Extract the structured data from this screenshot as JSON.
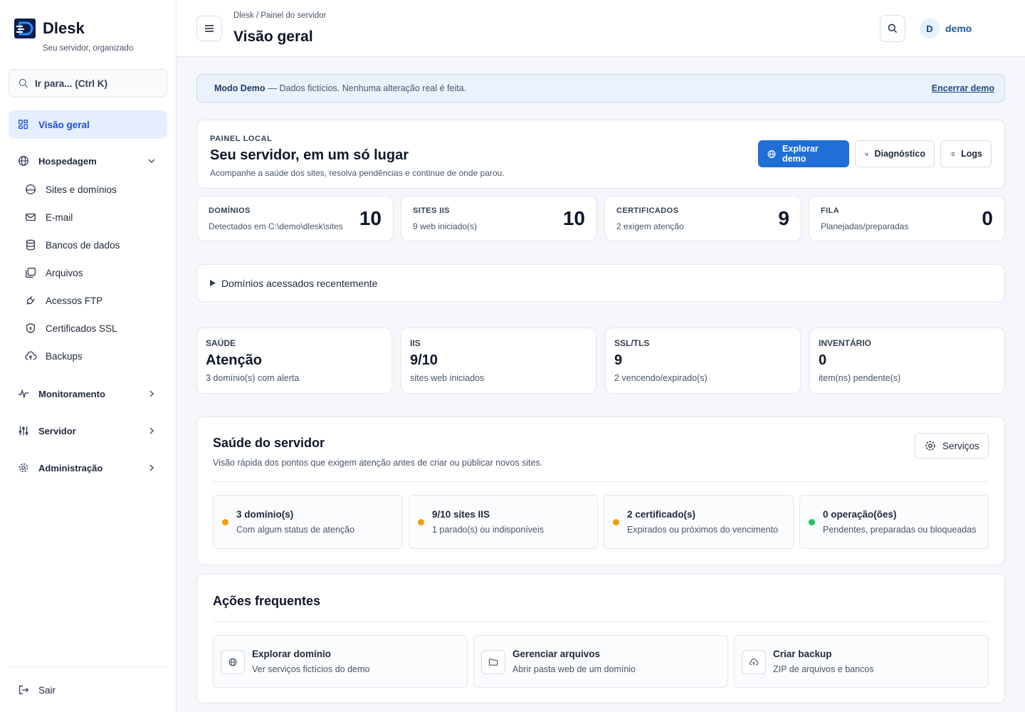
{
  "brand": {
    "name": "Dlesk",
    "tagline": "Seu servidor, organizado"
  },
  "search": {
    "label": "Ir para... (Ctrl K)"
  },
  "sidebar": {
    "items": [
      {
        "label": "Visão geral",
        "icon": "grid-icon",
        "active": true
      },
      {
        "label": "Hospedagem",
        "icon": "globe-icon",
        "group": true
      },
      {
        "label": "Sites e domínios",
        "icon": "www-icon"
      },
      {
        "label": "E-mail",
        "icon": "mail-icon"
      },
      {
        "label": "Bancos de dados",
        "icon": "database-icon"
      },
      {
        "label": "Arquivos",
        "icon": "files-icon"
      },
      {
        "label": "Acessos FTP",
        "icon": "plug-icon"
      },
      {
        "label": "Certificados SSL",
        "icon": "shield-icon"
      },
      {
        "label": "Backups",
        "icon": "cloud-upload-icon"
      },
      {
        "label": "Monitoramento",
        "icon": "pulse-icon",
        "group": true
      },
      {
        "label": "Servidor",
        "icon": "sliders-icon",
        "group": true
      },
      {
        "label": "Administração",
        "icon": "gear-icon",
        "group": true
      }
    ],
    "logout": "Sair"
  },
  "header": {
    "breadcrumb": "Dlesk / Painel do servidor",
    "title": "Visão geral",
    "user_initial": "D",
    "user_name": "demo"
  },
  "banner": {
    "strong": "Modo Demo",
    "text": "— Dados fictícios. Nenhuma alteração real é feita.",
    "action": "Encerrar demo"
  },
  "hero": {
    "eyebrow": "PAINEL LOCAL",
    "title": "Seu servidor, em um só lugar",
    "subtitle": "Acompanhe a saúde dos sites, resolva pendências e continue de onde parou.",
    "buttons": {
      "explore": "Explorar demo",
      "diagnostic": "Diagnóstico",
      "logs": "Logs"
    }
  },
  "stats": [
    {
      "label": "DOMÍNIOS",
      "sub": "Detectados em C:\\demo\\dlesk\\sites",
      "value": "10"
    },
    {
      "label": "SITES IIS",
      "sub": "9 web iniciado(s)",
      "value": "10"
    },
    {
      "label": "CERTIFICADOS",
      "sub": "2 exigem atenção",
      "value": "9"
    },
    {
      "label": "FILA",
      "sub": "Planejadas/preparadas",
      "value": "0"
    }
  ],
  "recent": {
    "label": "Domínios acessados recentemente"
  },
  "kpis": [
    {
      "label": "SAÚDE",
      "value": "Atenção",
      "sub": "3 domínio(s) com alerta"
    },
    {
      "label": "IIS",
      "value": "9/10",
      "sub": "sites web iniciados"
    },
    {
      "label": "SSL/TLS",
      "value": "9",
      "sub": "2 vencendo/expirado(s)"
    },
    {
      "label": "INVENTÁRIO",
      "value": "0",
      "sub": "item(ns) pendente(s)"
    }
  ],
  "health": {
    "title": "Saúde do servidor",
    "subtitle": "Visão rápida dos pontos que exigem atenção antes de criar ou públicar novos sites.",
    "button": "Serviços",
    "tiles": [
      {
        "title": "3 domínio(s)",
        "sub": "Com algum status de atenção",
        "color": "#f59e0b"
      },
      {
        "title": "9/10 sites IIS",
        "sub": "1 parado(s) ou indisponíveis",
        "color": "#f59e0b"
      },
      {
        "title": "2 certificado(s)",
        "sub": "Expirados ou próximos do vencimento",
        "color": "#f59e0b"
      },
      {
        "title": "0 operação(ões)",
        "sub": "Pendentes, preparadas ou bloqueadas",
        "color": "#22c55e"
      }
    ]
  },
  "actions": {
    "title": "Ações frequentes",
    "items": [
      {
        "title": "Explorar domínio",
        "sub": "Ver serviços fictícios do demo",
        "icon": "globe-icon"
      },
      {
        "title": "Gerenciar arquivos",
        "sub": "Abrir pasta web de um domínio",
        "icon": "folder-icon"
      },
      {
        "title": "Criar backup",
        "sub": "ZIP de arquivos e bancos",
        "icon": "cloud-upload-icon"
      }
    ]
  },
  "colors": {
    "accent": "#1f6fd6",
    "active_bg": "#e6efff",
    "warning": "#f59e0b",
    "ok": "#22c55e"
  }
}
